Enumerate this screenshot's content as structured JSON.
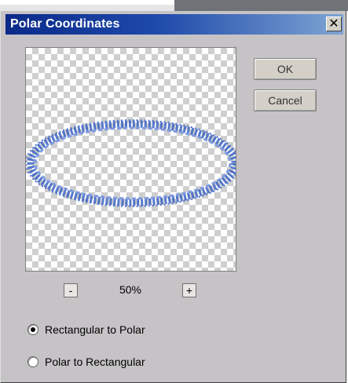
{
  "window": {
    "title": "Polar Coordinates"
  },
  "buttons": {
    "ok": "OK",
    "cancel": "Cancel"
  },
  "zoom": {
    "minus": "-",
    "level": "50%",
    "plus": "+"
  },
  "options": [
    {
      "label": "Rectangular to Polar",
      "selected": true
    },
    {
      "label": "Polar to Rectangular",
      "selected": false
    }
  ],
  "icons": {
    "close": "close-icon"
  },
  "colors": {
    "title_bar_start": "#0b2a8a",
    "title_bar_end": "#7fa4d4",
    "dialog_bg": "#c6c3c6",
    "preview_text": "#3a63c4"
  }
}
